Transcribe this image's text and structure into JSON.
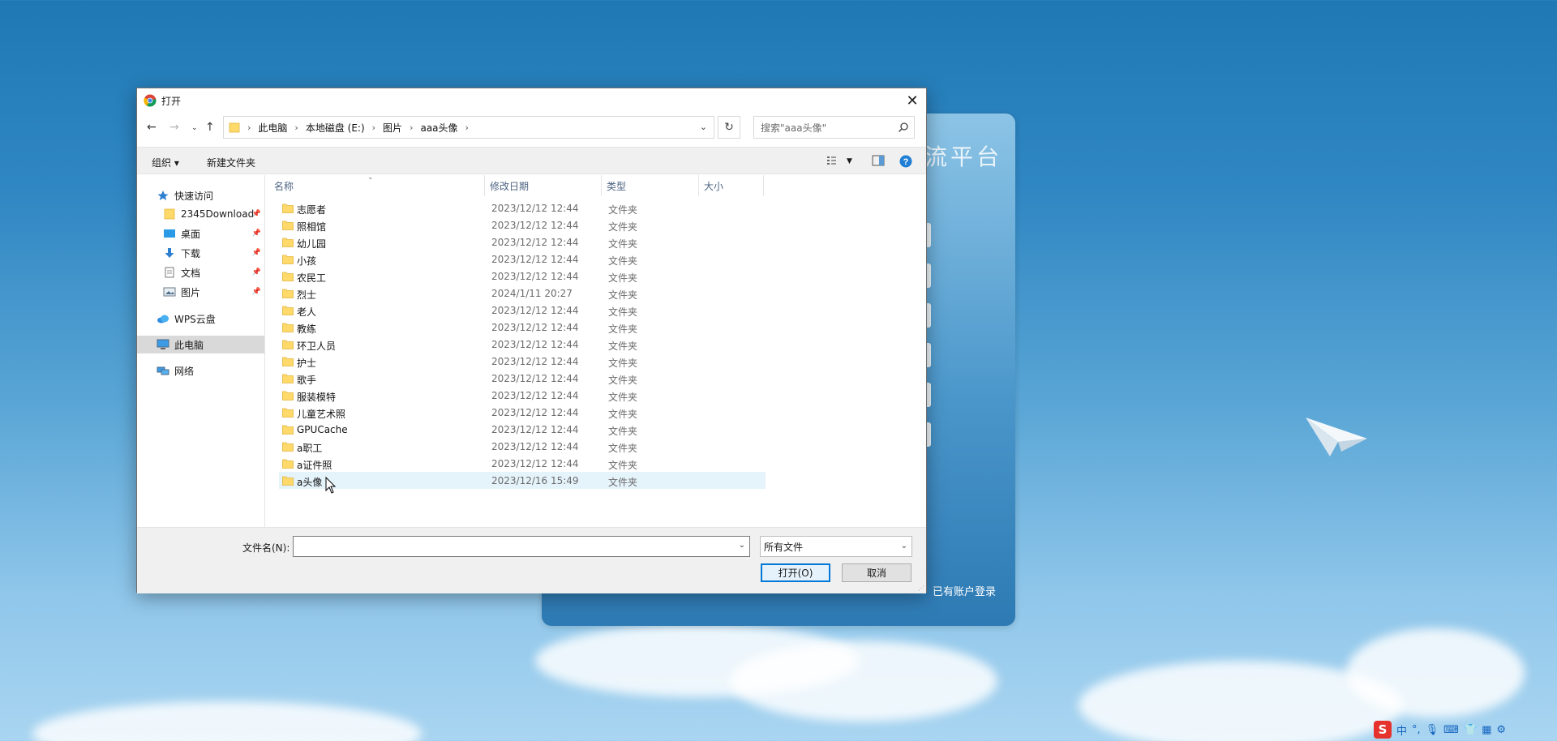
{
  "background": {
    "partial_title": "流平台",
    "login_link": "已有账户登录"
  },
  "dialog": {
    "title": "打开",
    "close_icon": "close-icon",
    "nav": {
      "back_icon": "arrow-left-icon",
      "forward_icon": "arrow-right-icon",
      "recent_icon": "chevron-down-icon",
      "up_icon": "arrow-up-icon"
    },
    "breadcrumb": [
      "此电脑",
      "本地磁盘 (E:)",
      "图片",
      "aaa头像"
    ],
    "search": {
      "placeholder": "搜索\"aaa头像\""
    },
    "toolbar": {
      "organize": "组织 ▾",
      "new_folder": "新建文件夹"
    },
    "nav_pane": {
      "quick_access": "快速访问",
      "items": [
        {
          "label": "2345Download",
          "icon": "folder-icon",
          "pinned": true
        },
        {
          "label": "桌面",
          "icon": "desktop-icon",
          "pinned": true
        },
        {
          "label": "下载",
          "icon": "download-icon",
          "pinned": true
        },
        {
          "label": "文档",
          "icon": "document-icon",
          "pinned": true
        },
        {
          "label": "图片",
          "icon": "picture-icon",
          "pinned": true
        }
      ],
      "wps": "WPS云盘",
      "this_pc": "此电脑",
      "network": "网络"
    },
    "columns": {
      "name": "名称",
      "date": "修改日期",
      "type": "类型",
      "size": "大小"
    },
    "files": [
      {
        "name": "志愿者",
        "date": "2023/12/12 12:44",
        "type": "文件夹"
      },
      {
        "name": "照相馆",
        "date": "2023/12/12 12:44",
        "type": "文件夹"
      },
      {
        "name": "幼儿园",
        "date": "2023/12/12 12:44",
        "type": "文件夹"
      },
      {
        "name": "小孩",
        "date": "2023/12/12 12:44",
        "type": "文件夹"
      },
      {
        "name": "农民工",
        "date": "2023/12/12 12:44",
        "type": "文件夹"
      },
      {
        "name": "烈士",
        "date": "2024/1/11 20:27",
        "type": "文件夹"
      },
      {
        "name": "老人",
        "date": "2023/12/12 12:44",
        "type": "文件夹"
      },
      {
        "name": "教练",
        "date": "2023/12/12 12:44",
        "type": "文件夹"
      },
      {
        "name": "环卫人员",
        "date": "2023/12/12 12:44",
        "type": "文件夹"
      },
      {
        "name": "护士",
        "date": "2023/12/12 12:44",
        "type": "文件夹"
      },
      {
        "name": "歌手",
        "date": "2023/12/12 12:44",
        "type": "文件夹"
      },
      {
        "name": "服装模特",
        "date": "2023/12/12 12:44",
        "type": "文件夹"
      },
      {
        "name": "儿童艺术照",
        "date": "2023/12/12 12:44",
        "type": "文件夹"
      },
      {
        "name": "GPUCache",
        "date": "2023/12/12 12:44",
        "type": "文件夹"
      },
      {
        "name": "a职工",
        "date": "2023/12/12 12:44",
        "type": "文件夹"
      },
      {
        "name": "a证件照",
        "date": "2023/12/12 12:44",
        "type": "文件夹"
      },
      {
        "name": "a头像",
        "date": "2023/12/16 15:49",
        "type": "文件夹",
        "selected": true
      }
    ],
    "filename_label": "文件名(N):",
    "filename_value": "",
    "filetype": "所有文件",
    "open_button": "打开(O)",
    "cancel_button": "取消"
  },
  "ime": {
    "logo": "S",
    "mode": "中",
    "punct": "°,"
  }
}
